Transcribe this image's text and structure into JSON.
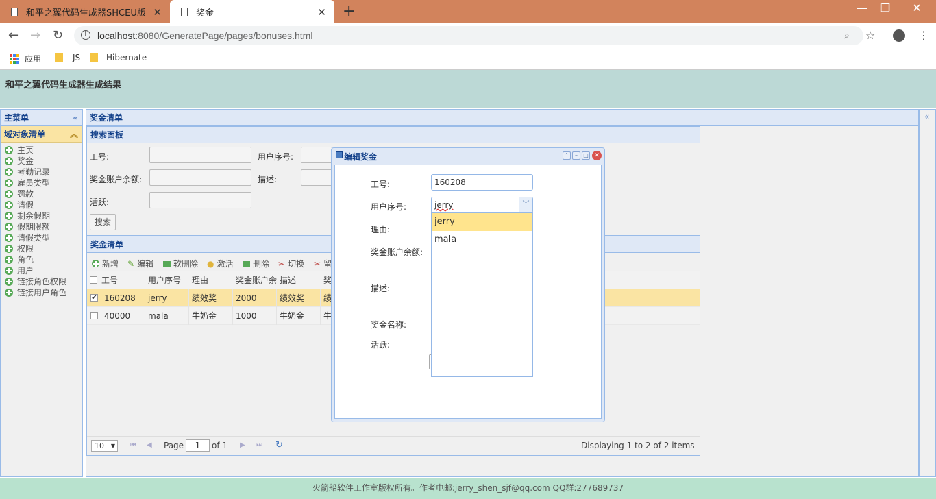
{
  "browser": {
    "tabs": [
      {
        "title": "和平之翼代码生成器SHCEU版",
        "active": false
      },
      {
        "title": "奖金",
        "active": true
      }
    ],
    "url_host": "localhost",
    "url_rest": ":8080/GeneratePage/pages/bonuses.html",
    "bookmarks": [
      "应用",
      "JS",
      "Hibernate"
    ]
  },
  "app": {
    "title": "和平之翼代码生成器生成结果",
    "footer": "火箭船软件工作室版权所有。作者电邮:jerry_shen_sjf@qq.com QQ群:277689737"
  },
  "sidebar": {
    "title": "主菜单",
    "section": "域对象清单",
    "items": [
      "主页",
      "奖金",
      "考勤记录",
      "雇员类型",
      "罚款",
      "请假",
      "剩余假期",
      "假期限额",
      "请假类型",
      "权限",
      "角色",
      "用户",
      "链接角色权限",
      "链接用户角色"
    ]
  },
  "center": {
    "title": "奖金清单",
    "search": {
      "title": "搜索面板",
      "labels": [
        "工号:",
        "用户序号:",
        "奖金账户余额:",
        "描述:",
        "活跃:"
      ],
      "button": "搜索"
    },
    "grid": {
      "title": "奖金清单",
      "toolbar": [
        "新增",
        "编辑",
        "软删除",
        "激活",
        "删除",
        "切换",
        "留"
      ],
      "columns": [
        "工号",
        "用户序号",
        "理由",
        "奖金账户余",
        "描述",
        "奖"
      ],
      "rows": [
        {
          "checked": true,
          "cells": [
            "160208",
            "jerry",
            "绩效奖",
            "2000",
            "绩效奖",
            "绩"
          ]
        },
        {
          "checked": false,
          "cells": [
            "40000",
            "mala",
            "牛奶金",
            "1000",
            "牛奶金",
            "牛"
          ]
        }
      ]
    },
    "pager": {
      "page_size": "10",
      "page_label": "Page",
      "page": "1",
      "of_label": "of 1",
      "display": "Displaying 1 to 2 of 2 items"
    }
  },
  "dialog": {
    "title": "编辑奖金",
    "labels": [
      "工号:",
      "用户序号:",
      "理由:",
      "奖金账户余额:",
      "描述:",
      "奖金名称:",
      "活跃:"
    ],
    "emp_no": "160208",
    "user_field": "jerry",
    "options": [
      "jerry",
      "mala"
    ],
    "selected_option": "jerry"
  },
  "colors": {
    "accent": "#15428b",
    "tabbar": "#d2835c",
    "header": "#bcd9d6",
    "footer": "#b8e2ce",
    "selected": "#fae4a3"
  }
}
